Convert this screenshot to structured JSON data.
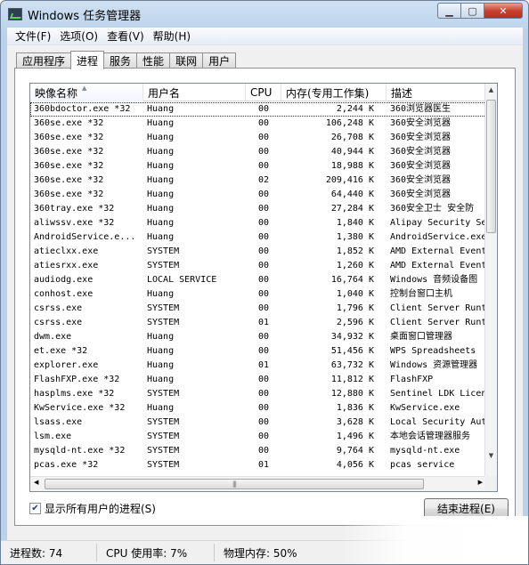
{
  "window": {
    "title": "Windows 任务管理器",
    "controls": {
      "minimize": "▁",
      "maximize": "▢",
      "close": "✕"
    }
  },
  "menu": [
    "文件(F)",
    "选项(O)",
    "查看(V)",
    "帮助(H)"
  ],
  "tabs": [
    {
      "label": "应用程序",
      "active": false
    },
    {
      "label": "进程",
      "active": true
    },
    {
      "label": "服务",
      "active": false
    },
    {
      "label": "性能",
      "active": false
    },
    {
      "label": "联网",
      "active": false
    },
    {
      "label": "用户",
      "active": false
    }
  ],
  "columns": [
    "映像名称",
    "用户名",
    "CPU",
    "内存(专用工作集)",
    "描述"
  ],
  "rows": [
    [
      "360bdoctor.exe *32",
      "Huang",
      "00",
      "2,244 K",
      "360浏览器医生"
    ],
    [
      "360se.exe *32",
      "Huang",
      "00",
      "106,248 K",
      "360安全浏览器"
    ],
    [
      "360se.exe *32",
      "Huang",
      "00",
      "26,708 K",
      "360安全浏览器"
    ],
    [
      "360se.exe *32",
      "Huang",
      "00",
      "40,944 K",
      "360安全浏览器"
    ],
    [
      "360se.exe *32",
      "Huang",
      "00",
      "18,988 K",
      "360安全浏览器"
    ],
    [
      "360se.exe *32",
      "Huang",
      "02",
      "209,416 K",
      "360安全浏览器"
    ],
    [
      "360se.exe *32",
      "Huang",
      "00",
      "64,440 K",
      "360安全浏览器"
    ],
    [
      "360tray.exe *32",
      "Huang",
      "00",
      "27,284 K",
      "360安全卫士 安全防"
    ],
    [
      "aliwssv.exe *32",
      "Huang",
      "00",
      "1,840 K",
      "Alipay Security Se"
    ],
    [
      "AndroidService.e...",
      "Huang",
      "00",
      "1,380 K",
      "AndroidService.exe"
    ],
    [
      "atieclxx.exe",
      "SYSTEM",
      "00",
      "1,852 K",
      "AMD External Event"
    ],
    [
      "atiesrxx.exe",
      "SYSTEM",
      "00",
      "1,260 K",
      "AMD External Event"
    ],
    [
      "audiodg.exe",
      "LOCAL SERVICE",
      "00",
      "16,764 K",
      "Windows 音频设备图"
    ],
    [
      "conhost.exe",
      "Huang",
      "00",
      "1,040 K",
      "控制台窗口主机"
    ],
    [
      "csrss.exe",
      "SYSTEM",
      "00",
      "1,796 K",
      "Client Server Runt"
    ],
    [
      "csrss.exe",
      "SYSTEM",
      "01",
      "2,596 K",
      "Client Server Runt"
    ],
    [
      "dwm.exe",
      "Huang",
      "00",
      "34,932 K",
      "桌面窗口管理器"
    ],
    [
      "et.exe *32",
      "Huang",
      "00",
      "51,456 K",
      "WPS Spreadsheets"
    ],
    [
      "explorer.exe",
      "Huang",
      "01",
      "63,732 K",
      "Windows 资源管理器"
    ],
    [
      "FlashFXP.exe *32",
      "Huang",
      "00",
      "11,812 K",
      "FlashFXP"
    ],
    [
      "hasplms.exe *32",
      "SYSTEM",
      "00",
      "12,880 K",
      "Sentinel LDK Licen"
    ],
    [
      "KwService.exe *32",
      "Huang",
      "00",
      "1,836 K",
      "KwService.exe"
    ],
    [
      "lsass.exe",
      "SYSTEM",
      "00",
      "3,628 K",
      "Local Security Aut"
    ],
    [
      "lsm.exe",
      "SYSTEM",
      "00",
      "1,496 K",
      "本地会话管理器服务"
    ],
    [
      "mysqld-nt.exe *32",
      "SYSTEM",
      "00",
      "9,764 K",
      "mysqld-nt.exe"
    ],
    [
      "pcas.exe *32",
      "SYSTEM",
      "01",
      "4,056 K",
      "pcas service"
    ]
  ],
  "show_all_label": "显示所有用户的进程(S)",
  "show_all_checked": true,
  "end_process_label": "结束进程(E)",
  "status": {
    "processes": "进程数: 74",
    "cpu": "CPU 使用率: 7%",
    "memory": "物理内存: 50%"
  }
}
